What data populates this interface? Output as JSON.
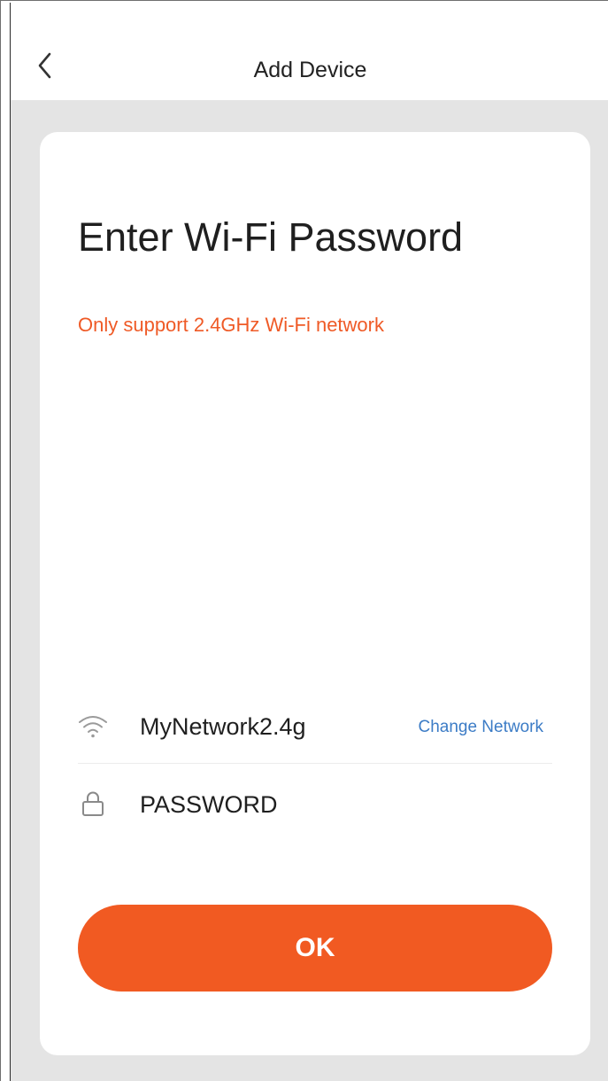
{
  "header": {
    "title": "Add Device",
    "back_icon": "chevron-left-icon"
  },
  "card": {
    "heading": "Enter Wi-Fi Password",
    "warning": "Only support 2.4GHz Wi-Fi network"
  },
  "network": {
    "icon": "wifi-icon",
    "name": "MyNetwork2.4g",
    "change_label": "Change Network"
  },
  "password": {
    "icon": "lock-icon",
    "value": "PASSWORD"
  },
  "actions": {
    "ok_label": "OK"
  },
  "colors": {
    "accent": "#f15a22",
    "warning": "#ef5a26",
    "link": "#3c7cc6",
    "background": "#e4e4e4",
    "text": "#1f1f1f"
  }
}
